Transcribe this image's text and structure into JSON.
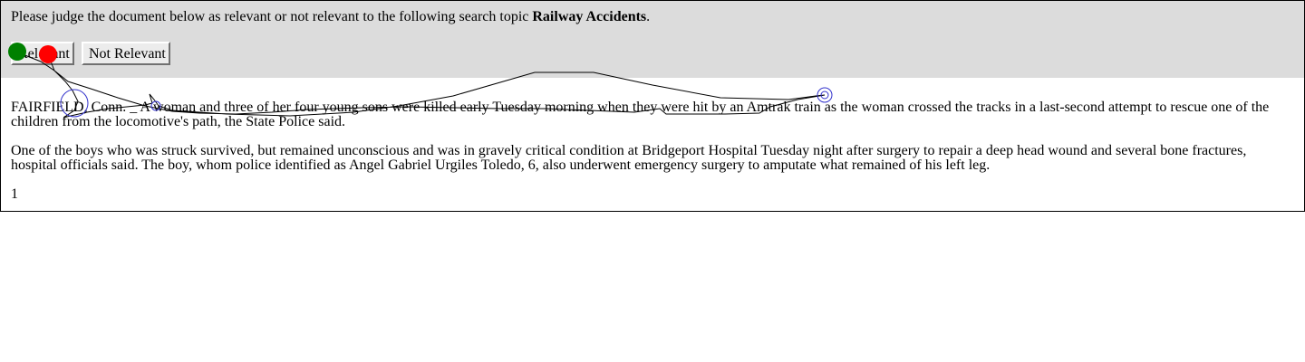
{
  "prompt": {
    "text": "Please judge the document below as relevant or not relevant to the following search topic ",
    "topic": "Railway Accidents",
    "suffix": "."
  },
  "buttons": {
    "relevant": "Relevant",
    "not_relevant": "Not Relevant"
  },
  "document": {
    "paragraphs": [
      "FAIRFIELD, Conn. _ A woman and three of her four young sons were killed early Tuesday morning when they were hit by an Amtrak train as the woman crossed the tracks in a last-second attempt to rescue one of the children from the locomotive's path, the State Police said.",
      "One of the boys who was struck survived, but remained unconscious and was in gravely critical condition at Bridgeport Hospital Tuesday night after surgery to repair a deep head wound and several bone fractures, hospital officials said. The boy, whom police identified as Angel Gabriel Urgiles Toledo, 6, also underwent emergency surgery to amputate what remained of his left leg."
    ],
    "page_number": "1"
  },
  "overlay": {
    "start_marker_color": "#008000",
    "end_marker_color": "#ff0000",
    "path_color": "#000000",
    "fixation_color": "#3333cc"
  }
}
